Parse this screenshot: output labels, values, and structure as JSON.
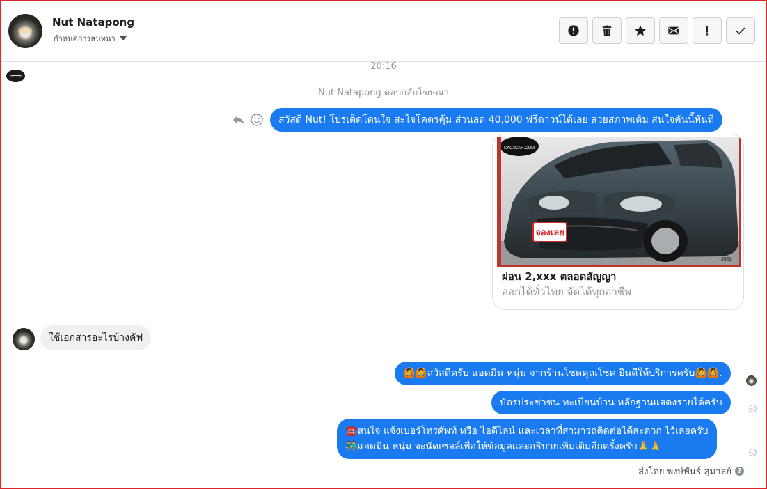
{
  "header": {
    "contact_name": "Nut Natapong",
    "conversation_label": "กำหนดการสนทนา",
    "action_icons": [
      "exclamation-circle-icon",
      "trash-icon",
      "star-icon",
      "envelope-icon",
      "exclamation-icon",
      "checkmark-icon"
    ]
  },
  "thread": {
    "time": "20:16",
    "replied_note": "Nut Natapong ตอบกลับโฆษณา",
    "ad_message": "สวัสดี Nut! โปรเด็ดโดนใจ สะใจโคตรคุ้ม ส่วนลด 40,000 ฟรีดาวน์ได้เลย สวยสภาพเดิม สนใจคันนี้ทันที",
    "ad_card": {
      "image_watermark": "CKC2CAR.COM",
      "image_badge": "จองเลย",
      "image_code": "J081",
      "title": "ผ่อน 2,xxx ตลอดสัญญา",
      "subtitle": "ออกได้ทั่วไทย จัดได้ทุกอาชีพ"
    },
    "incoming_message": "ใช้เอกสารอะไรบ้างคัฟ",
    "reply_1": {
      "emoji_left": "🙆🙆",
      "text": "สวัสดีครับ แอดมิน หนุ่ม จากร้านโชคคุณโชค ยินดีให้บริการครับ",
      "emoji_right": "🙆🙆."
    },
    "reply_2": "บัตรประชาชน ทะเบียนบ้าน หลักฐานแสดงรายได้ครับ",
    "reply_3": {
      "line1_emoji": "☎️",
      "line1": "สนใจ แจ้งเบอร์โทรศัพท์ หรือ ไอดีไลน์ และเวลาที่สามารถติดต่อได้สะดวก ไว้เลยครับ",
      "line2_emoji": "👬",
      "line2": "แอดมิน หนุ่ม จะนัดเซลล์เพื่อให้ข้อมูลและอธิบายเพิ่มเติมอีกครั้งครับ",
      "line2_tail": "🙏🙏"
    },
    "sent_by": "ส่งโดย พงษ์พันธ์ สุมาลย์",
    "help_glyph": "?"
  },
  "colors": {
    "accent": "#1a7bf0",
    "incoming_bubble": "#f1f0f0",
    "frame_border": "#d9262b"
  }
}
